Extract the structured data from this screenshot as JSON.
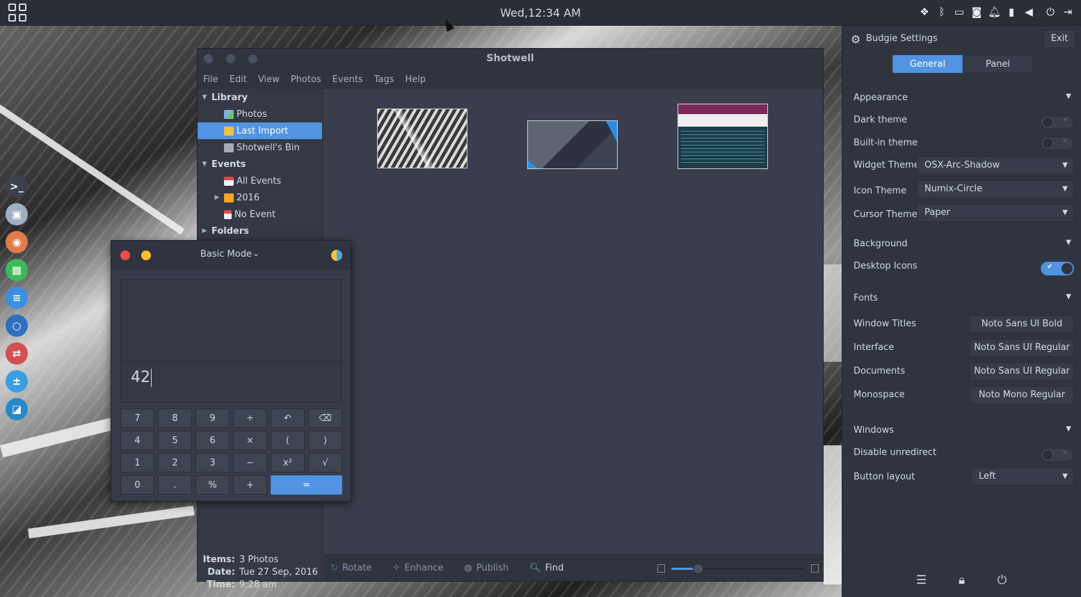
{
  "top_panel": {
    "clock": "Wed,12:34 AM",
    "tray_icons": [
      "dropbox-icon",
      "bluetooth-icon",
      "display-icon",
      "caffeine-icon",
      "notification-icon",
      "battery-icon",
      "volume-icon",
      "power-icon",
      "logout-icon"
    ]
  },
  "dock": {
    "items": [
      {
        "name": "terminal",
        "glyph": ">_",
        "color": "#3c4150"
      },
      {
        "name": "file-manager",
        "glyph": "▣",
        "color": "#9fb0c4"
      },
      {
        "name": "media",
        "glyph": "◉",
        "color": "#e07b4a"
      },
      {
        "name": "spreadsheet",
        "glyph": "▦",
        "color": "#3cba5a"
      },
      {
        "name": "document",
        "glyph": "≡",
        "color": "#3b8fe0"
      },
      {
        "name": "browser",
        "glyph": "○",
        "color": "#2f6fbf"
      },
      {
        "name": "toggles",
        "glyph": "⇄",
        "color": "#d35050"
      },
      {
        "name": "calculator",
        "glyph": "±",
        "color": "#3a9ee0"
      },
      {
        "name": "photos",
        "glyph": "◪",
        "color": "#2a88c9"
      }
    ]
  },
  "shotwell": {
    "title": "Shotwell",
    "menu": [
      "File",
      "Edit",
      "View",
      "Photos",
      "Events",
      "Tags",
      "Help"
    ],
    "sidebar": {
      "library": "Library",
      "photos": "Photos",
      "last_import": "Last Import",
      "bin": "Shotwell's Bin",
      "events": "Events",
      "all_events": "All Events",
      "year": "2016",
      "no_event": "No Event",
      "folders": "Folders"
    },
    "info": {
      "items_label": "Items:",
      "items_value": "3 Photos",
      "date_label": "Date:",
      "date_value": "Tue 27 Sep, 2016",
      "time_label": "Time:",
      "time_value": "9:28 am"
    },
    "toolbar": {
      "rotate": "Rotate",
      "enhance": "Enhance",
      "publish": "Publish",
      "find": "Find"
    },
    "zoom_level": 0.2
  },
  "calculator": {
    "mode": "Basic Mode",
    "value": "42",
    "keys": [
      {
        "label": "7",
        "name": "key-7"
      },
      {
        "label": "8",
        "name": "key-8"
      },
      {
        "label": "9",
        "name": "key-9"
      },
      {
        "label": "÷",
        "name": "key-divide"
      },
      {
        "label": "↶",
        "name": "key-undo"
      },
      {
        "label": "⌫",
        "name": "key-backspace"
      },
      {
        "label": "4",
        "name": "key-4"
      },
      {
        "label": "5",
        "name": "key-5"
      },
      {
        "label": "6",
        "name": "key-6"
      },
      {
        "label": "×",
        "name": "key-multiply"
      },
      {
        "label": "(",
        "name": "key-open-paren"
      },
      {
        "label": ")",
        "name": "key-close-paren"
      },
      {
        "label": "1",
        "name": "key-1"
      },
      {
        "label": "2",
        "name": "key-2"
      },
      {
        "label": "3",
        "name": "key-3"
      },
      {
        "label": "−",
        "name": "key-minus"
      },
      {
        "label": "x²",
        "name": "key-square"
      },
      {
        "label": "√",
        "name": "key-sqrt"
      },
      {
        "label": "0",
        "name": "key-0"
      },
      {
        "label": ".",
        "name": "key-decimal"
      },
      {
        "label": "%",
        "name": "key-percent"
      },
      {
        "label": "+",
        "name": "key-plus"
      },
      {
        "label": "=",
        "name": "key-equals",
        "eq": true
      }
    ]
  },
  "budgie": {
    "title": "Budgie Settings",
    "exit": "Exit",
    "tabs": {
      "general": "General",
      "panel": "Panel"
    },
    "appearance": {
      "heading": "Appearance",
      "dark_theme": "Dark theme",
      "builtin_theme": "Built-in theme",
      "widget_theme_label": "Widget Theme",
      "widget_theme_value": "OSX-Arc-Shadow",
      "icon_theme_label": "Icon Theme",
      "icon_theme_value": "Numix-Circle",
      "cursor_theme_label": "Cursor Theme",
      "cursor_theme_value": "Paper"
    },
    "background": {
      "heading": "Background",
      "desktop_icons": "Desktop Icons"
    },
    "fonts": {
      "heading": "Fonts",
      "window_titles_label": "Window Titles",
      "window_titles_value": "Noto Sans UI Bold",
      "interface_label": "Interface",
      "interface_value": "Noto Sans UI Regular",
      "documents_label": "Documents",
      "documents_value": "Noto Sans UI Regular",
      "monospace_label": "Monospace",
      "monospace_value": "Noto Mono Regular"
    },
    "windows": {
      "heading": "Windows",
      "disable_unredirect": "Disable unredirect",
      "button_layout_label": "Button layout",
      "button_layout_value": "Left"
    },
    "toggles": {
      "dark_theme": false,
      "builtin_theme": false,
      "desktop_icons": true,
      "disable_unredirect": false
    },
    "accent": "#5294e2"
  }
}
